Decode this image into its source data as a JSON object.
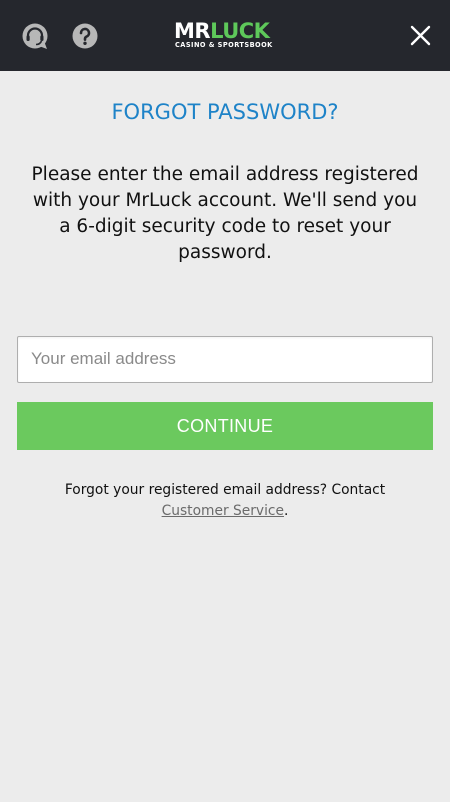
{
  "header": {
    "logo_mr": "MR",
    "logo_luck": "LUCK",
    "logo_tagline": "CASINO & SPORTSBOOK",
    "support_icon": "support-chat-icon",
    "help_icon": "question-icon",
    "close_icon": "close-icon"
  },
  "form": {
    "title": "FORGOT PASSWORD?",
    "instructions": "Please enter the email address registered with your MrLuck account. We'll send you a 6-digit security code to reset your password.",
    "email_placeholder": "Your email address",
    "email_value": "",
    "continue_label": "CONTINUE",
    "note_text": "Forgot your registered email address? Contact",
    "note_link": "Customer Service",
    "note_end": "."
  },
  "colors": {
    "header_bg": "#25272d",
    "page_bg": "#ececec",
    "title": "#1e83c8",
    "button": "#6bc95e",
    "logo_accent": "#5ec85a"
  }
}
